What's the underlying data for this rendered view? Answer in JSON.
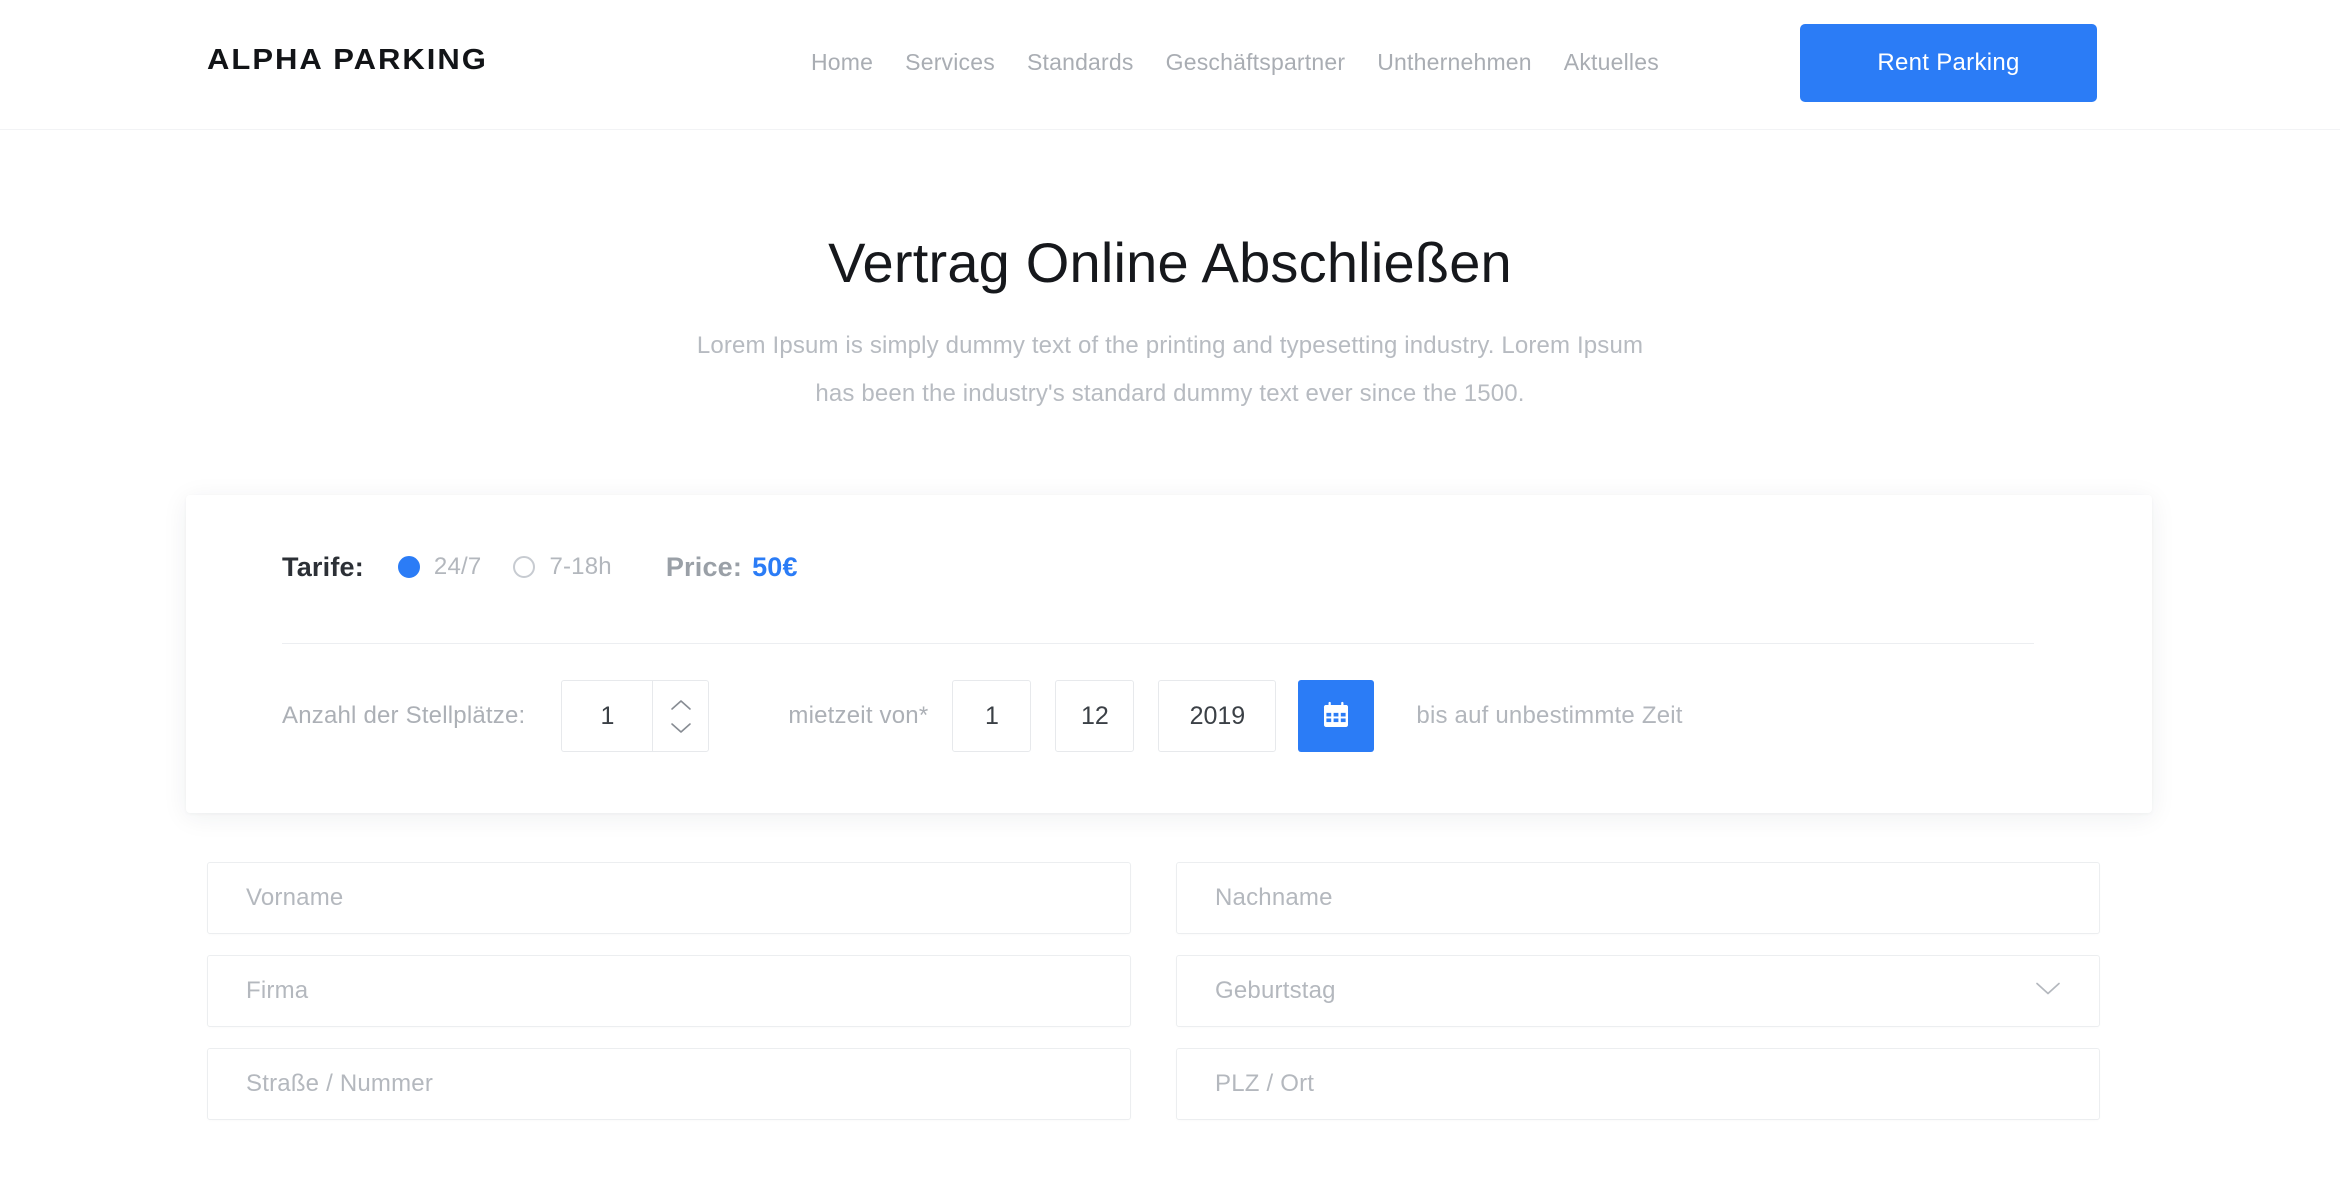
{
  "header": {
    "brand": "ALPHA PARKING",
    "nav": [
      {
        "label": "Home"
      },
      {
        "label": "Services"
      },
      {
        "label": "Standards"
      },
      {
        "label": "Geschäftspartner"
      },
      {
        "label": "Unthernehmen"
      },
      {
        "label": "Aktuelles"
      }
    ],
    "cta_label": "Rent Parking",
    "accent_color": "#2b7cf6"
  },
  "hero": {
    "title": "Vertrag Online Abschließen",
    "subtitle_line1": "Lorem Ipsum is simply dummy text of the printing and typesetting industry. Lorem Ipsum",
    "subtitle_line2": "has been the industry's standard dummy text ever since the 1500."
  },
  "tarif_card": {
    "tarife_label": "Tarife:",
    "options": [
      {
        "label": "24/7",
        "selected": true
      },
      {
        "label": "7-18h",
        "selected": false
      }
    ],
    "price_label": "Price:",
    "price_value": "50€",
    "spaces_label": "Anzahl der Stellplätze:",
    "spaces_value": "1",
    "mietzeit_label": "mietzeit von*",
    "date_day": "1",
    "date_month": "12",
    "date_year": "2019",
    "calendar_icon": "calendar-icon",
    "note": "bis auf unbestimmte Zeit"
  },
  "form": {
    "fields": [
      {
        "name": "vorname",
        "placeholder": "Vorname",
        "type": "text"
      },
      {
        "name": "nachname",
        "placeholder": "Nachname",
        "type": "text"
      },
      {
        "name": "firma",
        "placeholder": "Firma",
        "type": "text"
      },
      {
        "name": "geburtstag",
        "placeholder": "Geburtstag",
        "type": "select"
      },
      {
        "name": "strasse-nummer",
        "placeholder": "Straße / Nummer",
        "type": "text"
      },
      {
        "name": "plz-ort",
        "placeholder": "PLZ / Ort",
        "type": "text"
      }
    ]
  }
}
